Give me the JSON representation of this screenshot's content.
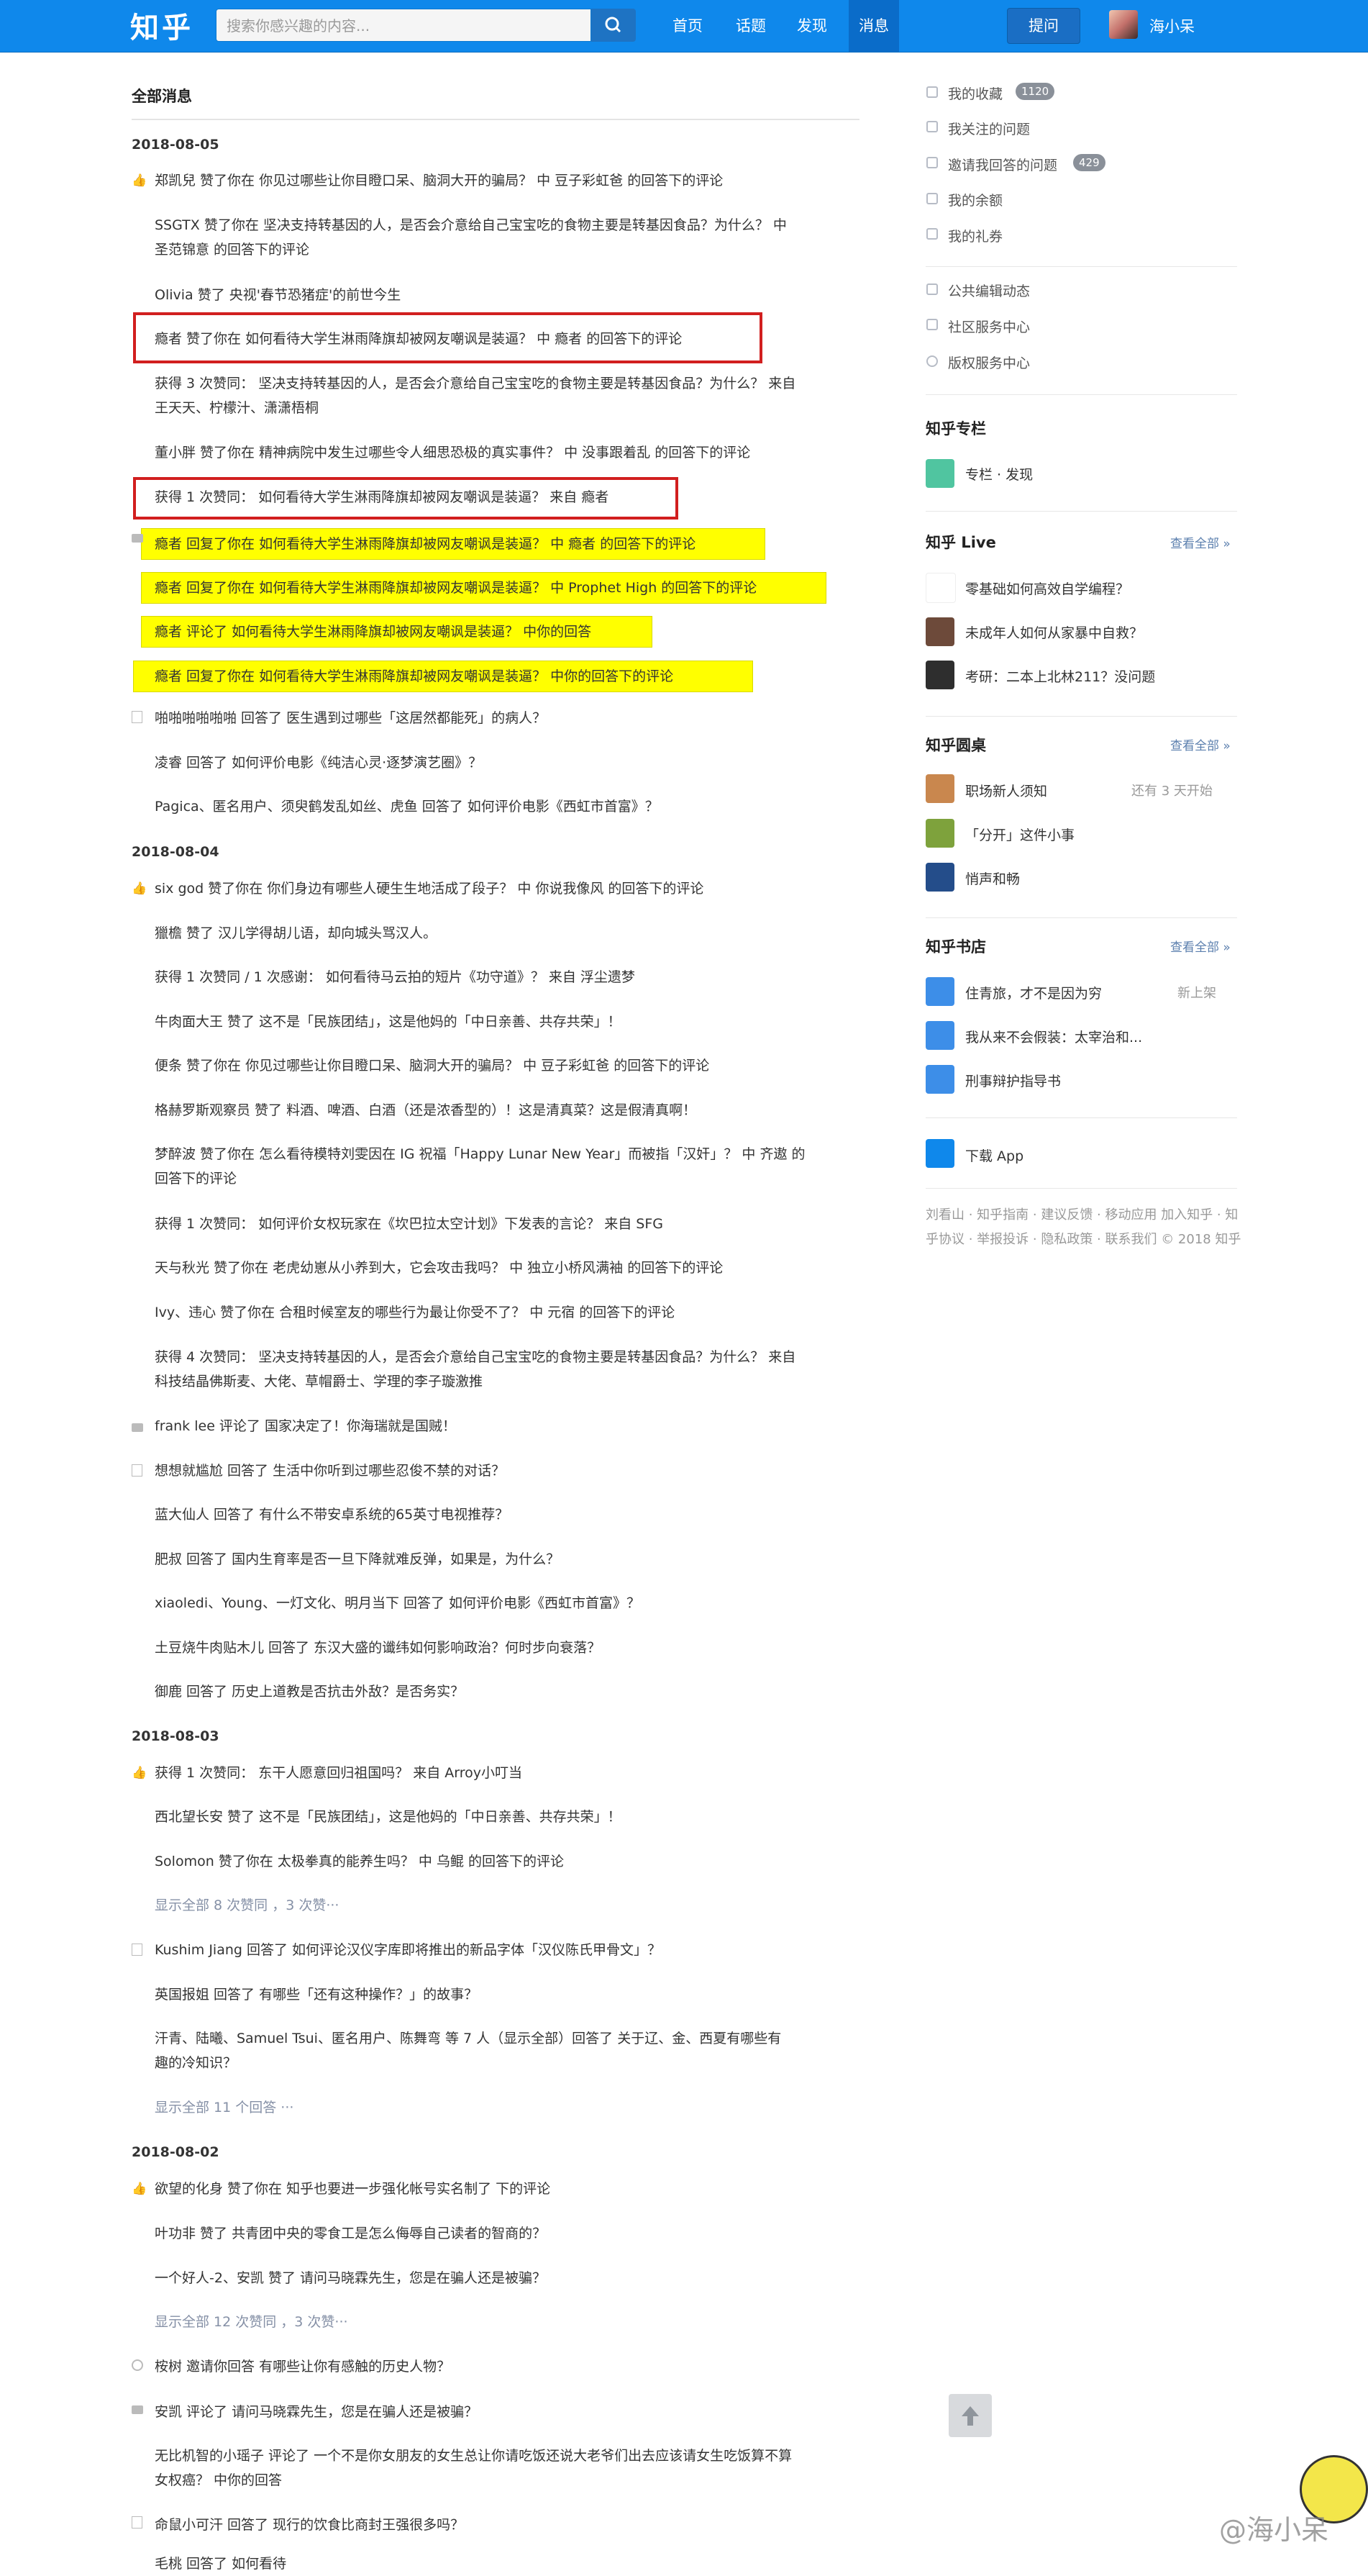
{
  "header": {
    "logo": "知乎",
    "search_placeholder": "搜索你感兴趣的内容...",
    "nav": [
      "首页",
      "话题",
      "发现",
      "消息"
    ],
    "ask": "提问",
    "user": "海小呆"
  },
  "main": {
    "title": "全部消息",
    "dates": [
      "2018-08-05",
      "2018-08-04",
      "2018-08-03",
      "2018-08-02"
    ],
    "items": [
      "郑凯兒 赞了你在 你见过哪些让你目瞪口呆、脑洞大开的骗局？ 中 豆子彩虹爸 的回答下的评论",
      "SSGTX 赞了你在 坚决支持转基因的人，是否会介意给自己宝宝吃的食物主要是转基因食品？为什么？ 中",
      "圣范锦意 的回答下的评论",
      "Olivia 赞了 央视'春节恐猪症'的前世今生",
      "瘾者 赞了你在 如何看待大学生淋雨降旗却被网友嘲讽是装逼？ 中 瘾者 的回答下的评论",
      "获得 3 次赞同： 坚决支持转基因的人，是否会介意给自己宝宝吃的食物主要是转基因食品？为什么？ 来自",
      "王天天、柠檬汁、潇潇梧桐",
      "董小胖 赞了你在 精神病院中发生过哪些令人细思恐极的真实事件？ 中 没事跟着乱 的回答下的评论",
      "获得 1 次赞同： 如何看待大学生淋雨降旗却被网友嘲讽是装逼？ 来自 瘾者",
      "瘾者 回复了你在 如何看待大学生淋雨降旗却被网友嘲讽是装逼？ 中 瘾者 的回答下的评论",
      "瘾者 回复了你在 如何看待大学生淋雨降旗却被网友嘲讽是装逼？ 中 Prophet High 的回答下的评论",
      "瘾者 评论了 如何看待大学生淋雨降旗却被网友嘲讽是装逼？ 中你的回答",
      "瘾者 回复了你在 如何看待大学生淋雨降旗却被网友嘲讽是装逼？ 中你的回答下的评论",
      "啪啪啪啪啪啪 回答了 医生遇到过哪些「这居然都能死」的病人？",
      "凌睿 回答了 如何评价电影《纯洁心灵·逐梦演艺圈》？",
      "Pagica、匿名用户、须臾鹤发乱如丝、虎鱼 回答了 如何评价电影《西虹市首富》？",
      "six god 赞了你在 你们身边有哪些人硬生生地活成了段子？ 中 你说我像风 的回答下的评论",
      "獵檐 赞了 汉儿学得胡儿语，却向城头骂汉人。",
      "获得 1 次赞同 / 1 次感谢： 如何看待马云拍的短片《功守道》？ 来自 浮尘遗梦",
      "牛肉面大王 赞了 这不是「民族团结」，这是他妈的「中日亲善、共存共荣」！",
      "便条 赞了你在 你见过哪些让你目瞪口呆、脑洞大开的骗局？ 中 豆子彩虹爸 的回答下的评论",
      "格赫罗斯观察员 赞了 料酒、啤酒、白酒（还是浓香型的）！这是清真菜？这是假清真啊！",
      "梦醉波 赞了你在 怎么看待模特刘雯因在 IG 祝福「Happy Lunar New Year」而被指「汉奸」？ 中 齐遨 的",
      "回答下的评论",
      "获得 1 次赞同： 如何评价女权玩家在《坎巴拉太空计划》下发表的言论？ 来自 SFG",
      "天与秋光 赞了你在 老虎幼崽从小养到大，它会攻击我吗？ 中 独立小桥风满袖 的回答下的评论",
      "Ivy、违心 赞了你在 合租时候室友的哪些行为最让你受不了？ 中 元宿 的回答下的评论",
      "获得 4 次赞同： 坚决支持转基因的人，是否会介意给自己宝宝吃的食物主要是转基因食品？为什么？ 来自",
      "科技结晶佛斯麦、大佬、草帽爵士、学理的李子璇激推",
      "frank lee 评论了 国家决定了！你海瑞就是国贼！",
      "想想就尴尬 回答了 生活中你听到过哪些忍俊不禁的对话？",
      "蓝大仙人 回答了 有什么不带安卓系统的65英寸电视推荐？",
      "肥叔 回答了 国内生育率是否一旦下降就难反弹，如果是，为什么？",
      "xiaoledi、Young、一灯文化、明月当下 回答了 如何评价电影《西虹市首富》？",
      "土豆烧牛肉贴木儿 回答了 东汉大盛的谶纬如何影响政治？何时步向衰落？",
      "御鹿 回答了 历史上道教是否抗击外敌？是否务实？",
      "获得 1 次赞同： 东干人愿意回归祖国吗？ 来自 Arroy小叮当",
      "西北望长安 赞了 这不是「民族团结」，这是他妈的「中日亲善、共存共荣」！",
      "Solomon 赞了你在 太极拳真的能养生吗？ 中 乌鲲 的回答下的评论",
      "显示全部 8 次赞同 ，3 次赞···",
      "Kushim Jiang 回答了 如何评论汉仪字库即将推出的新品字体「汉仪陈氏甲骨文」？",
      "英国报姐 回答了 有哪些「还有这种操作？」的故事？",
      "汗青、陆曦、Samuel Tsui、匿名用户、陈舞弯 等 7 人（显示全部）回答了 关于辽、金、西夏有哪些有",
      "趣的冷知识？",
      "显示全部 11 个回答 ···",
      "欲望的化身 赞了你在 知乎也要进一步强化帐号实名制了 下的评论",
      "叶功非 赞了 共青团中央的零食工是怎么侮辱自己读者的智商的？",
      "一个好人-2、安凯 赞了 请问马晓霖先生，您是在骗人还是被骗？",
      "显示全部 12 次赞同 ，3 次赞···",
      "桉树 邀请你回答 有哪些让你有感触的历史人物？",
      "安凯 评论了 请问马晓霖先生，您是在骗人还是被骗？",
      "无比机智的小瑶子 评论了 一个不是你女朋友的女生总让你请吃饭还说大老爷们出去应该请女生吃饭算不算",
      "女权癌？ 中你的回答",
      "命鼠小可汗 回答了 现行的饮食比商封王强很多吗？",
      "毛桃 回答了 如何看待"
    ]
  },
  "sidebar": {
    "links": [
      {
        "label": "我的收藏",
        "badge": "1120"
      },
      {
        "label": "我关注的问题",
        "badge": ""
      },
      {
        "label": "邀请我回答的问题",
        "badge": "429"
      },
      {
        "label": "我的余额",
        "badge": ""
      },
      {
        "label": "我的礼券",
        "badge": ""
      }
    ],
    "links2": [
      "公共编辑动态",
      "社区服务中心",
      "版权服务中心"
    ],
    "column_head": "知乎专栏",
    "column_item": "专栏 · 发现",
    "live_head": "知乎 Live",
    "live_more": "查看全部 »",
    "live_items": [
      "零基础如何高效自学编程？",
      "未成年人如何从家暴中自救？",
      "考研：二本上北林211？没问题"
    ],
    "round_head": "知乎圆桌",
    "round_more": "查看全部 »",
    "round_items": [
      "职场新人须知",
      "「分开」这件小事",
      "悄声和畅"
    ],
    "round_extra": "还有 3 天开始",
    "book_head": "知乎书店",
    "book_more": "查看全部 »",
    "book_items": [
      "住青旅，才不是因为穷",
      "我从来不会假装：太宰治和...",
      "刑事辩护指导书"
    ],
    "book_extra": "新上架",
    "download": "下载 App",
    "footer": "刘看山 · 知乎指南 · 建议反馈 · 移动应用 加入知乎 · 知乎协议 · 举报投诉 · 隐私政策 · 联系我们 © 2018 知乎"
  },
  "watermark": "@海小呆"
}
